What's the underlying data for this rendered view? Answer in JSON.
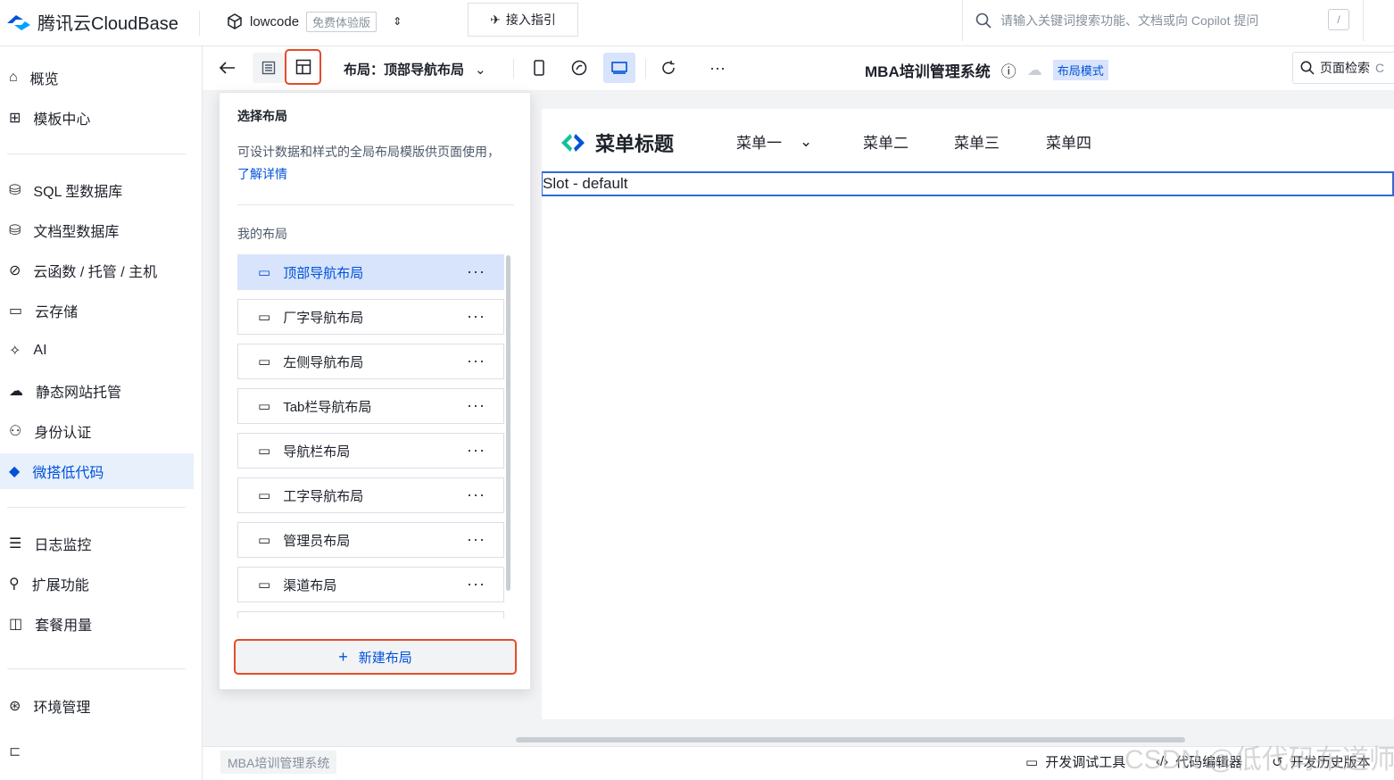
{
  "header": {
    "brand": "腾讯云CloudBase",
    "env_name": "lowcode",
    "env_badge": "免费体验版",
    "guide_label": "接入指引",
    "search_placeholder": "请输入关键词搜索功能、文档或向 Copilot 提问",
    "search_shortcut": "/"
  },
  "sidebar": {
    "items": [
      {
        "label": "概览",
        "icon": "home-icon"
      },
      {
        "label": "模板中心",
        "icon": "grid-icon"
      },
      {
        "label": "SQL 型数据库",
        "icon": "sql-db-icon"
      },
      {
        "label": "文档型数据库",
        "icon": "doc-db-icon"
      },
      {
        "label": "云函数 / 托管 / 主机",
        "icon": "function-icon"
      },
      {
        "label": "云存储",
        "icon": "storage-icon"
      },
      {
        "label": "AI",
        "icon": "ai-sparkle-icon"
      },
      {
        "label": "静态网站托管",
        "icon": "hosting-icon"
      },
      {
        "label": "身份认证",
        "icon": "user-auth-icon"
      },
      {
        "label": "微搭低代码",
        "icon": "lowcode-icon"
      },
      {
        "label": "日志监控",
        "icon": "log-icon"
      },
      {
        "label": "扩展功能",
        "icon": "extension-icon"
      },
      {
        "label": "套餐用量",
        "icon": "package-icon"
      },
      {
        "label": "环境管理",
        "icon": "env-icon"
      }
    ],
    "active": "微搭低代码"
  },
  "toolbar": {
    "layout_label": "布局：顶部导航布局",
    "app_title": "MBA培训管理系统",
    "mode_badge": "布局模式",
    "page_search": "页面检索",
    "page_search_extra": "C"
  },
  "layout_panel": {
    "title": "选择布局",
    "description": "可设计数据和样式的全局布局模版供页面使用，",
    "learn_more": "了解详情",
    "my_layouts_label": "我的布局",
    "layouts": [
      "顶部导航布局",
      "厂字导航布局",
      "左侧导航布局",
      "Tab栏导航布局",
      "导航栏布局",
      "工字导航布局",
      "管理员布局",
      "渠道布局"
    ],
    "selected": "顶部导航布局",
    "more_glyph": "···",
    "new_button": "新建布局",
    "new_button_icon": "+"
  },
  "canvas": {
    "menu_title": "菜单标题",
    "menus": [
      "菜单一",
      "菜单二",
      "菜单三",
      "菜单四"
    ],
    "slot_text": "Slot - default"
  },
  "bottom": {
    "tab": "MBA培训管理系统",
    "dev_tools": "开发调试工具",
    "code_editor": "代码编辑器",
    "history": "开发历史版本"
  },
  "watermark": "CSDN @低代码布道师",
  "colors": {
    "accent": "#0052d9",
    "highlight_border": "#e34d2c",
    "selected_bg": "#d7e4fb"
  }
}
